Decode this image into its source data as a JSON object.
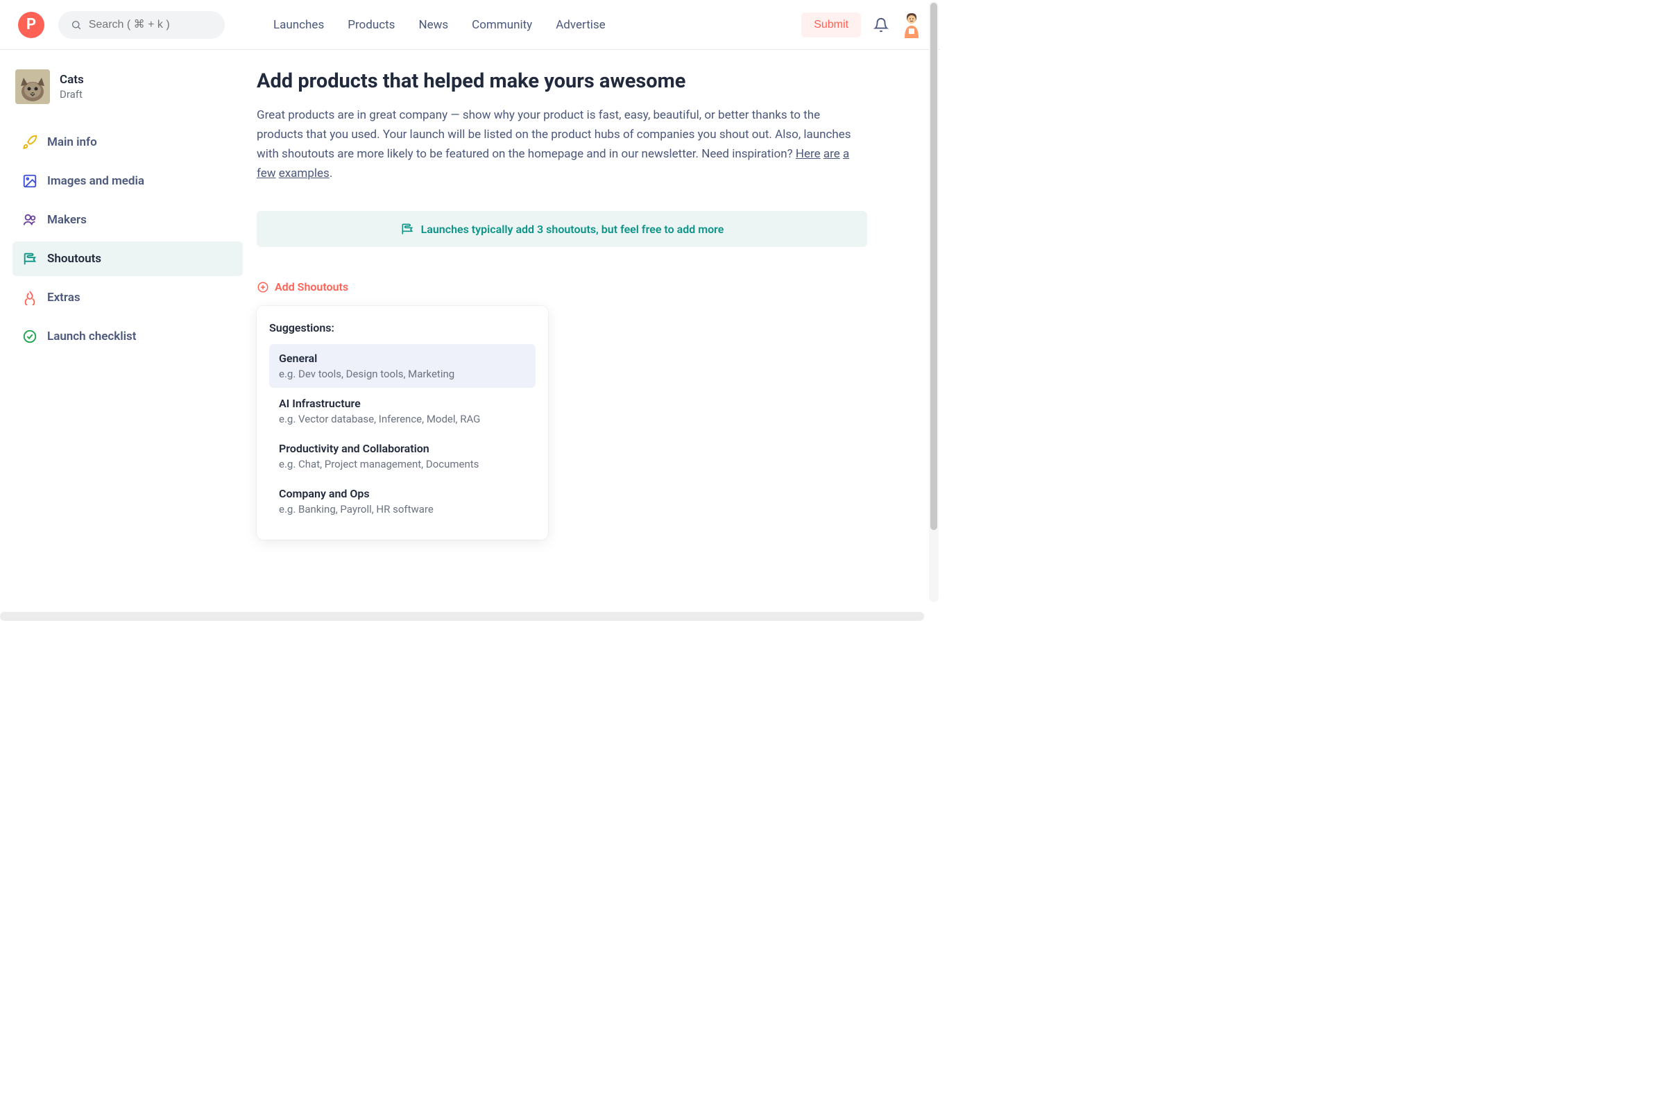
{
  "header": {
    "search_placeholder": "Search ( ⌘ + k )",
    "nav": [
      "Launches",
      "Products",
      "News",
      "Community",
      "Advertise"
    ],
    "submit_label": "Submit"
  },
  "sidebar": {
    "product_name": "Cats",
    "product_status": "Draft",
    "items": [
      {
        "label": "Main info",
        "icon": "rocket"
      },
      {
        "label": "Images and media",
        "icon": "image"
      },
      {
        "label": "Makers",
        "icon": "users"
      },
      {
        "label": "Shoutouts",
        "icon": "flag",
        "active": true
      },
      {
        "label": "Extras",
        "icon": "fire"
      },
      {
        "label": "Launch checklist",
        "icon": "check-circle"
      }
    ]
  },
  "main": {
    "title": "Add products that helped make yours awesome",
    "desc_prefix": "Great products are in great company — show why your product is fast, easy, beautiful, or better thanks to the products that you used. Your launch will be listed on the product hubs of companies you shout out. Also, launches with shoutouts are more likely to be featured on the homepage and in our newsletter. Need inspiration? ",
    "desc_links": [
      "Here",
      "are",
      "a",
      "few",
      "examples"
    ],
    "banner_text": "Launches typically add 3 shoutouts, but feel free to add more",
    "add_label": "Add Shoutouts",
    "suggestions_title": "Suggestions:",
    "suggestions": [
      {
        "name": "General",
        "desc": "e.g. Dev tools, Design tools, Marketing",
        "selected": true
      },
      {
        "name": "AI Infrastructure",
        "desc": "e.g. Vector database, Inference, Model, RAG"
      },
      {
        "name": "Productivity and Collaboration",
        "desc": "e.g. Chat, Project management, Documents"
      },
      {
        "name": "Company and Ops",
        "desc": "e.g. Banking, Payroll, HR software"
      }
    ]
  }
}
